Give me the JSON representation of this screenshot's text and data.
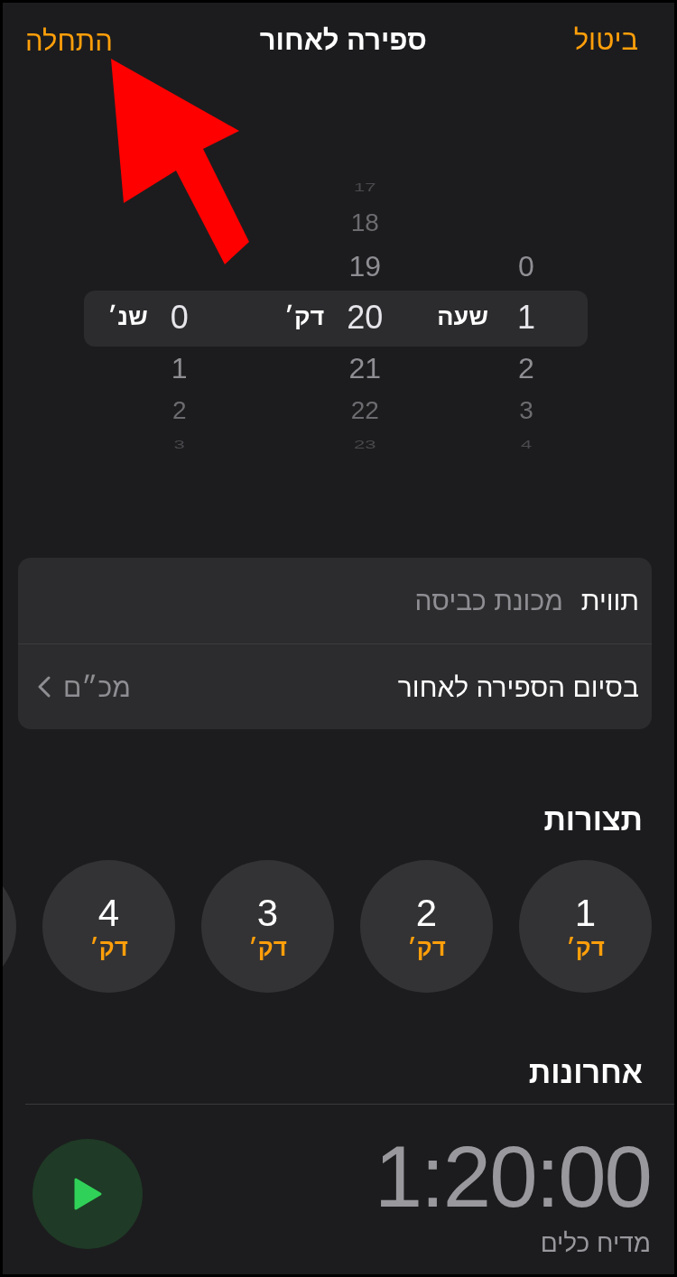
{
  "header": {
    "start": "התחלה",
    "title": "ספירה לאחור",
    "cancel": "ביטול"
  },
  "picker": {
    "columns": [
      {
        "unit": "שעה",
        "items": [
          {
            "value": "0",
            "selected": false
          },
          {
            "value": "1",
            "selected": true
          },
          {
            "value": "2",
            "selected": false
          },
          {
            "value": "3",
            "selected": false
          },
          {
            "value": "4",
            "selected": false
          }
        ]
      },
      {
        "unit": "דק׳",
        "items": [
          {
            "value": "17",
            "selected": false
          },
          {
            "value": "18",
            "selected": false
          },
          {
            "value": "19",
            "selected": false
          },
          {
            "value": "20",
            "selected": true
          },
          {
            "value": "21",
            "selected": false
          },
          {
            "value": "22",
            "selected": false
          },
          {
            "value": "23",
            "selected": false
          }
        ]
      },
      {
        "unit": "שנ׳",
        "items": [
          {
            "value": "0",
            "selected": true
          },
          {
            "value": "1",
            "selected": false
          },
          {
            "value": "2",
            "selected": false
          },
          {
            "value": "3",
            "selected": false
          }
        ]
      }
    ]
  },
  "settings": [
    {
      "label": "תווית",
      "value": "מכונת כביסה",
      "kind": "field"
    },
    {
      "label": "בסיום הספירה לאחור",
      "value": "מכ״ם",
      "kind": "link"
    }
  ],
  "presets": {
    "title": "תצורות",
    "items": [
      {
        "number": "1",
        "unit": "דק׳"
      },
      {
        "number": "2",
        "unit": "דק׳"
      },
      {
        "number": "3",
        "unit": "דק׳"
      },
      {
        "number": "4",
        "unit": "דק׳"
      }
    ]
  },
  "recents": {
    "title": "אחרונות",
    "items": [
      {
        "time": "1:20:00",
        "label": "מדיח כלים"
      }
    ]
  }
}
